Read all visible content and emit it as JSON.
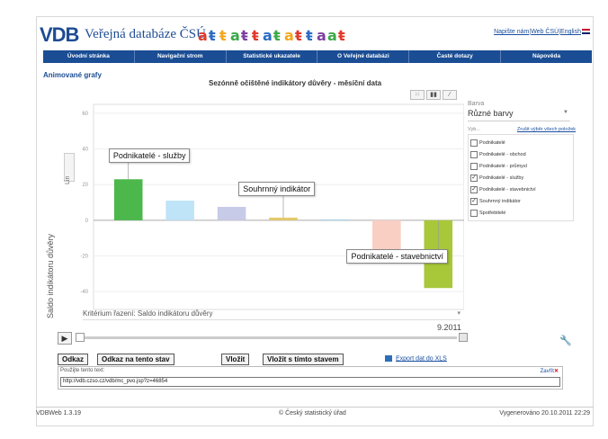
{
  "header": {
    "logo": "VDB",
    "title": "Veřejná databáze ČSÚ",
    "links": [
      "Napište nám",
      "Web ČSÚ",
      "English"
    ]
  },
  "nav": [
    "Úvodní stránka",
    "Navigační strom",
    "Statistické ukazatele",
    "O Veřejné databázi",
    "Časté dotazy",
    "Nápověda"
  ],
  "section_title": "Animované grafy",
  "chart_title": "Sezónně očištěné indikátory důvěry - měsíční data",
  "scale_button": "Lin",
  "yaxis_label": "Saldo indikátoru důvěry",
  "chart_data": {
    "type": "bar",
    "title": "Sezónně očištěné indikátory důvěry - měsíční data",
    "ylabel": "Saldo indikátoru důvěry",
    "ylim": [
      -50,
      65
    ],
    "ticks": [
      60,
      40,
      20,
      0,
      -20,
      -40
    ],
    "categories": [
      "Podnikatelé - služby",
      "Podnikatelé",
      "Podnikatelé - obchod",
      "Souhrnný indikátor",
      "Podnikatelé - průmysl",
      "Spotřebitelé",
      "Podnikatelé - stavebnictví"
    ],
    "values": [
      23,
      11,
      7.5,
      1.5,
      0.5,
      -19,
      -38
    ],
    "colors": [
      "#4cb84c",
      "#bfe3f7",
      "#c7cbe8",
      "#e6c96a",
      "#a7d8ea",
      "#f9cfc4",
      "#a8c83a"
    ],
    "callouts": [
      "Podnikatelé - služby",
      "Souhrnný indikátor",
      "Podnikatelé - stavebnictví"
    ]
  },
  "criterion": "Kritérium řazení: Saldo indikátoru důvěry",
  "time_label": "9.2011",
  "side": {
    "barva_label": "Barva",
    "barva_value": "Různé barvy",
    "vyb_label": "Vyb...",
    "clear_link": "Zrušit výběr všech položek",
    "items": [
      {
        "label": "Podnikatelé",
        "checked": false
      },
      {
        "label": "Podnikatelé - obchod",
        "checked": false
      },
      {
        "label": "Podnikatelé - průmysl",
        "checked": false
      },
      {
        "label": "Podnikatelé - služby",
        "checked": true
      },
      {
        "label": "Podnikatelé - stavebnictví",
        "checked": true
      },
      {
        "label": "Souhrnný indikátor",
        "checked": true
      },
      {
        "label": "Spotřebitelé",
        "checked": false
      }
    ]
  },
  "buttons": {
    "odkaz": "Odkaz",
    "odkaz_stav": "Odkaz na tento stav",
    "vlozit": "Vložit",
    "vlozit_stav": "Vložit s tímto stavem",
    "export": "Export dat do XLS"
  },
  "textbox": {
    "label": "Použijte tento text:",
    "close": "Zavřít",
    "url": "http://vdb.czso.cz/vdb/mc_pvo.jsp?z=46854"
  },
  "footer": {
    "version": "VDBWeb 1.3.19",
    "copyright": "© Český statistický úřad",
    "generated": "Vygenerováno 20.10.2011 22:29"
  }
}
